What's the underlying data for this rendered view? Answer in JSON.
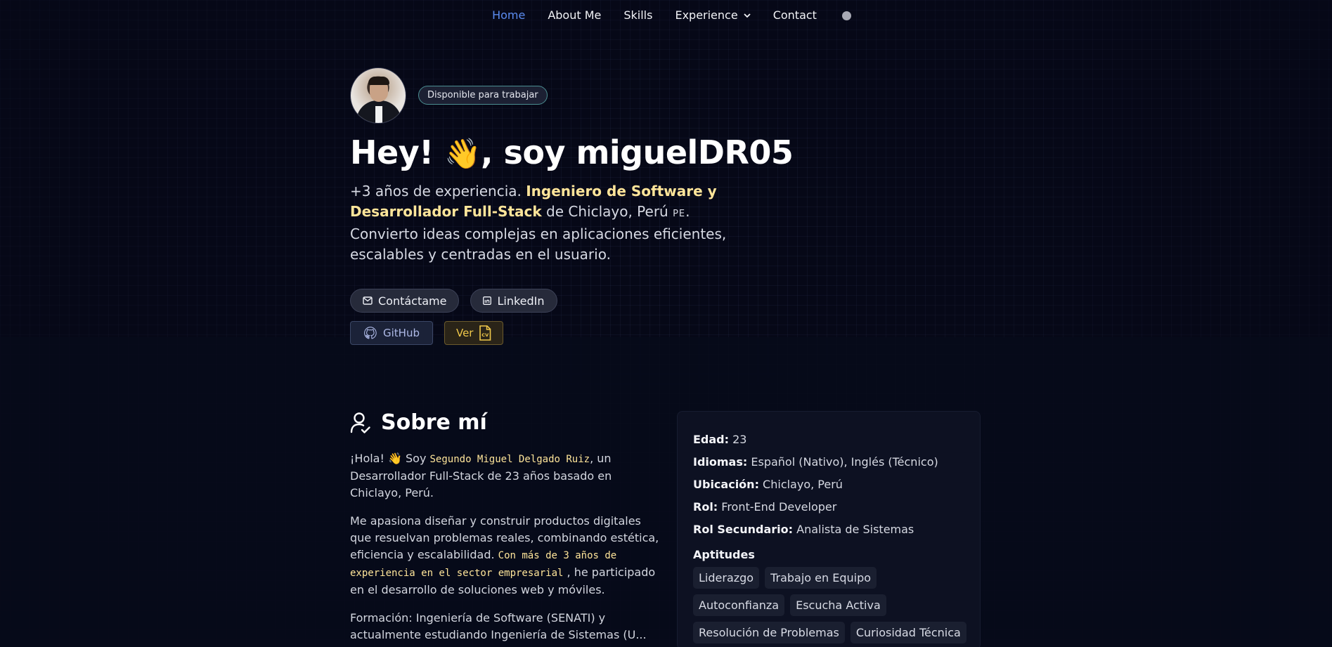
{
  "nav": {
    "items": [
      {
        "label": "Home",
        "active": true
      },
      {
        "label": "About Me",
        "active": false
      },
      {
        "label": "Skills",
        "active": false
      },
      {
        "label": "Experience",
        "active": false,
        "dropdown": true
      },
      {
        "label": "Contact",
        "active": false
      }
    ],
    "theme_toggle_icon": "circle-theme-toggle-icon"
  },
  "hero": {
    "badge": "Disponible para trabajar",
    "greeting_pre": "Hey! ",
    "greeting_emoji": "👋",
    "greeting_post": ", soy miguelDR05",
    "intro_pre": "+3 años de experiencia. ",
    "intro_highlight": "Ingeniero de Software y Desarrollador Full-Stack",
    "intro_mid": " de Chiclayo, Perú ",
    "intro_flag": "PE",
    "intro_post": ". Convierto ideas complejas en aplicaciones eficientes, escalables y centradas en el usuario.",
    "buttons": {
      "contact": "Contáctame",
      "linkedin": "LinkedIn",
      "github": "GitHub",
      "cv": "Ver"
    },
    "accent_highlight": "#ffe59a",
    "accent_active": "#5b8cf0"
  },
  "about": {
    "title": "Sobre mí",
    "p1_pre": "¡Hola! 👋 Soy ",
    "p1_name": "Segundo Miguel Delgado Ruiz",
    "p1_post": ", un Desarrollador Full-Stack de 23 años basado en Chiclayo, Perú.",
    "p2_pre": "Me apasiona diseñar y construir productos digitales que resuelvan problemas reales, combinando estética, eficiencia y escalabilidad. ",
    "p2_mono": "Con más de 3 años de experiencia en el sector empresarial",
    "p2_post": " , he participado en el desarrollo de soluciones web y móviles.",
    "p3": "Formación: Ingeniería de Software (SENATI) y actualmente estudiando Ingeniería de Sistemas (U..."
  },
  "info": {
    "edad_label": "Edad:",
    "edad": " 23",
    "idiomas_label": "Idiomas:",
    "idiomas": " Español (Nativo), Inglés (Técnico)",
    "ubicacion_label": "Ubicación:",
    "ubicacion": " Chiclayo, Perú",
    "rol_label": "Rol:",
    "rol": " Front-End Developer",
    "rol2_label": "Rol Secundario:",
    "rol2": " Analista de Sistemas",
    "aptitudes_title": "Aptitudes",
    "aptitudes": [
      "Liderazgo",
      "Trabajo en Equipo",
      "Autoconfianza",
      "Escucha Activa",
      "Resolución de Problemas",
      "Curiosidad Técnica"
    ]
  }
}
